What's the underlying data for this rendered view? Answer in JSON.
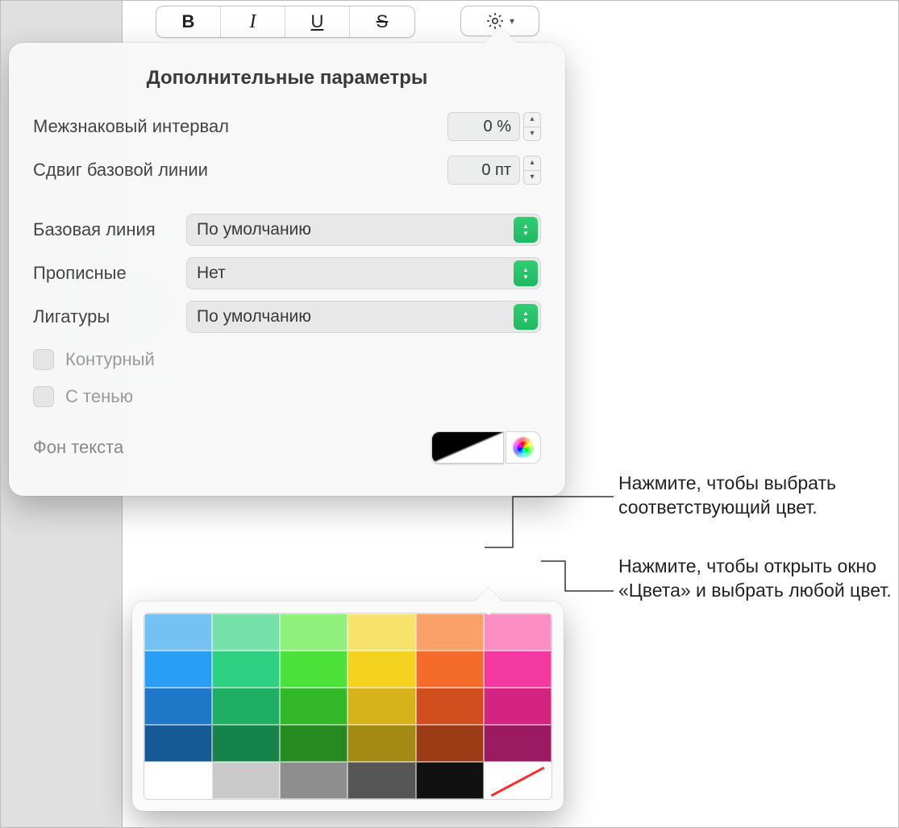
{
  "toolbar": {
    "bold": "B",
    "italic": "I",
    "underline": "U",
    "strike": "S"
  },
  "popover": {
    "title": "Дополнительные параметры",
    "char_spacing_label": "Межзнаковый интервал",
    "char_spacing_value": "0 %",
    "baseline_shift_label": "Сдвиг базовой линии",
    "baseline_shift_value": "0 пт",
    "baseline_label": "Базовая линия",
    "baseline_value": "По умолчанию",
    "caps_label": "Прописные",
    "caps_value": "Нет",
    "ligatures_label": "Лигатуры",
    "ligatures_value": "По умолчанию",
    "outline_label": "Контурный",
    "shadow_label": "С тенью",
    "text_bg_label": "Фон текста"
  },
  "callouts": {
    "c1": "Нажмите, чтобы выбрать соответствующий цвет.",
    "c2": "Нажмите, чтобы открыть окно «Цвета» и выбрать любой цвет."
  },
  "swatches": {
    "rows": [
      [
        "#74c1f4",
        "#75e0a7",
        "#8ff07c",
        "#f7e26c",
        "#faa069",
        "#fb8fc4"
      ],
      [
        "#2a9df4",
        "#2ed082",
        "#4ce23a",
        "#f4d320",
        "#f46b2a",
        "#f43aa1"
      ],
      [
        "#1f78c7",
        "#1fae63",
        "#33b82a",
        "#d6b31a",
        "#d14f1f",
        "#d32482"
      ],
      [
        "#155a94",
        "#16834a",
        "#258a1f",
        "#a38a14",
        "#9c3c17",
        "#9a1b61"
      ],
      [
        "#ffffff",
        "#c9c9c9",
        "#8e8e8e",
        "#565656",
        "#111111",
        "none"
      ]
    ]
  }
}
